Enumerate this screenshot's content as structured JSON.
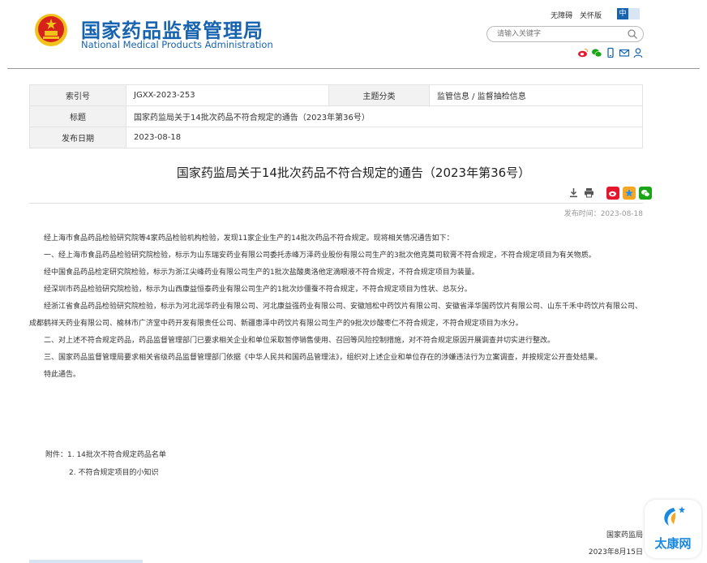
{
  "header": {
    "title_cn": "国家药品监督管理局",
    "title_en": "National Medical Products Administration",
    "top_links": [
      "无障碍",
      "关怀版"
    ],
    "lang": {
      "zh": "中",
      "en": ""
    },
    "search_placeholder": "请输入关键字"
  },
  "info": {
    "row1": {
      "label1": "索引号",
      "value1": "JGXX-2023-253",
      "label2": "主题分类",
      "value2": "监管信息 / 监督抽检信息"
    },
    "row2": {
      "label": "标题",
      "value": "国家药监局关于14批次药品不符合规定的通告（2023年第36号）"
    },
    "row3": {
      "label": "发布日期",
      "value": "2023-08-18"
    }
  },
  "article": {
    "title": "国家药监局关于14批次药品不符合规定的通告（2023年第36号）",
    "publish_label": "发布时间：2023-08-18",
    "paragraphs": [
      "经上海市食品药品检验研究院等4家药品检验机构检验，发现11家企业生产的14批次药品不符合规定。现将相关情况通告如下：",
      "一、经上海市食品药品检验研究院检验，标示为山东瑞安药业有限公司委托赤峰万泽药业股份有限公司生产的3批次他克莫司软膏不符合规定，不符合规定项目为有关物质。",
      "经中国食品药品检定研究院检验，标示为浙江尖峰药业有限公司生产的1批次盐酸奥洛他定滴眼液不符合规定，不符合规定项目为装量。",
      "经深圳市药品检验研究院检验，标示为山西康益恒泰药业有限公司生产的1批次炒僵蚕不符合规定，不符合规定项目为性状、总灰分。",
      "经浙江省食品药品检验研究院检验，标示为河北润华药业有限公司、河北康益强药业有限公司、安徽旭松中药饮片有限公司、安徽省泽华国药饮片有限公司、山东千禾中药饮片有限公司、成都鹤祥天药业有限公司、榆林市广济堂中药开发有限责任公司、新疆患泽中药饮片有限公司生产的9批次炒酸枣仁不符合规定，不符合规定项目为水分。",
      "二、对上述不符合规定药品，药品监督管理部门已要求相关企业和单位采取暂停销售使用、召回等风险控制措施，对不符合规定原因开展调查并切实进行整改。",
      "三、国家药品监督管理局要求相关省级药品监督管理部门依据《中华人民共和国药品管理法》，组织对上述企业和单位存在的涉嫌违法行为立案调查，并按规定公开查处结果。",
      "特此通告。"
    ],
    "attachments": [
      "附件：1. 14批次不符合规定药品名单",
      "2. 不符合规定项目的小知识"
    ],
    "signature": "国家药监局",
    "signature_date": "2023年8月15日"
  },
  "floating_badge": {
    "text": "太康网"
  },
  "colors": {
    "brand": "#1763b0",
    "emblem_red": "#d7221c",
    "emblem_gold": "#f2c21a"
  },
  "icons": [
    "emblem-icon",
    "search-icon",
    "weibo-icon",
    "wechat-icon",
    "mobile-icon",
    "mail-icon",
    "user-icon",
    "download-icon",
    "print-icon",
    "share-weibo-icon",
    "share-qzone-icon",
    "share-wechat-icon"
  ]
}
